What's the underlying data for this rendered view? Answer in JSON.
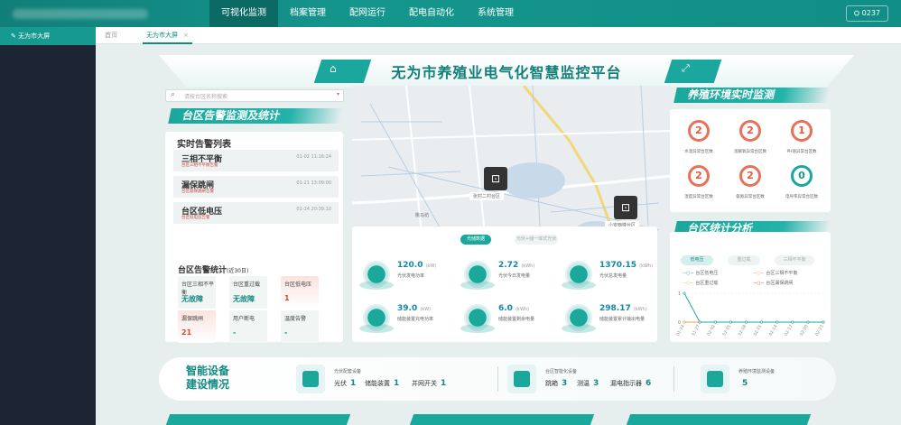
{
  "nav": {
    "items": [
      "可视化监测",
      "档案管理",
      "配网运行",
      "配电自动化",
      "系统管理"
    ],
    "user": "0237"
  },
  "sidebar": {
    "item": "无为市大屏"
  },
  "tabs": {
    "home": "首页",
    "active": "无为市大屏"
  },
  "header": {
    "title": "无为市养殖业电气化智慧监控平台"
  },
  "search": {
    "placeholder": "请按台区名称搜索"
  },
  "alarm_panel": {
    "title": "台区告警监测及统计",
    "list_title": "实时告警列表",
    "alarms": [
      {
        "title": "三相不平衡",
        "sub": "台区三相不平衡告警",
        "time": "01-02 11:16:24"
      },
      {
        "title": "漏保跳闸",
        "sub": "台区漏保跳闸告警",
        "time": "01-21 13:09:00"
      },
      {
        "title": "台区低电压",
        "sub": "台区低电压告警",
        "time": "01-24 20:39:10"
      }
    ],
    "stats_title": "台区告警统计",
    "stats_period": "(近30日)",
    "stats": [
      {
        "label": "台区三相不平衡",
        "value": "无故障"
      },
      {
        "label": "台区重过载",
        "value": "无故障"
      },
      {
        "label": "台区低电压",
        "value": "1"
      },
      {
        "label": "漏保跳闸",
        "value": "21"
      },
      {
        "label": "用户断电",
        "value": "-"
      },
      {
        "label": "温度告警",
        "value": "-"
      }
    ]
  },
  "map": {
    "markers": [
      "张村二村台区",
      "小安西楼台区"
    ],
    "places": [
      "桃马坊",
      "黄郢"
    ]
  },
  "power": {
    "tabs": [
      "光储数据",
      "光伏+储一体式光伏"
    ],
    "items": [
      {
        "value": "120.0",
        "unit": "(kW)",
        "label": "光伏发电功率"
      },
      {
        "value": "2.72",
        "unit": "(kWh)",
        "label": "光伏今日发电量"
      },
      {
        "value": "1370.15",
        "unit": "(kWh)",
        "label": "光伏总发电量"
      },
      {
        "value": "39.0",
        "unit": "(kW)",
        "label": "储能装置充电功率"
      },
      {
        "value": "6.0",
        "unit": "(kWh)",
        "label": "储能装置剩余电量"
      },
      {
        "value": "298.17",
        "unit": "(kWh)",
        "label": "储能装置累计输出电量"
      }
    ]
  },
  "env": {
    "title": "养殖环境实时监测",
    "items": [
      {
        "value": "2",
        "label": "水温异常台区数"
      },
      {
        "value": "2",
        "label": "溶解氧异常台区数"
      },
      {
        "value": "1",
        "label": "PH值异常台区数"
      },
      {
        "value": "2",
        "label": "湿度异常台区数"
      },
      {
        "value": "2",
        "label": "氨氮异常台区数"
      },
      {
        "value": "0",
        "label": "电导率异常台区数"
      }
    ]
  },
  "stat_panel": {
    "title": "台区统计分析",
    "tabs": [
      "低电压",
      "重过载",
      "三相不平衡"
    ]
  },
  "chart_data": {
    "type": "line",
    "x": [
      "01-24",
      "01-27",
      "02-02",
      "02-05",
      "02-08",
      "02-11",
      "02-14",
      "02-17",
      "02-20",
      "02-23"
    ],
    "series": [
      {
        "name": "台区低电压",
        "values": [
          1,
          0,
          0,
          0,
          0,
          0,
          0,
          0,
          0,
          0
        ],
        "color": "#1aa89d"
      },
      {
        "name": "台区三相不平衡",
        "values": [
          0,
          0,
          0,
          0,
          0,
          0,
          0,
          0,
          0,
          0
        ],
        "color": "#f0a04b"
      },
      {
        "name": "台区重过载",
        "values": [
          0,
          0,
          0,
          0,
          0,
          0,
          0,
          0,
          0,
          0
        ],
        "color": "#e6c14a"
      },
      {
        "name": "台区漏保跳闸",
        "values": [
          0,
          0,
          0,
          0,
          0,
          0,
          0,
          0,
          0,
          0
        ],
        "color": "#e0452e"
      }
    ],
    "ylim": [
      0,
      1
    ],
    "yticks": [
      "1",
      "0"
    ]
  },
  "bottom": {
    "title1": "智能设备",
    "title2": "建设情况",
    "groups": [
      {
        "title": "光伏配套设备",
        "items": [
          {
            "label": "光伏",
            "value": "1"
          },
          {
            "label": "储能装置",
            "value": "1"
          },
          {
            "label": "并网开关",
            "value": "1"
          }
        ]
      },
      {
        "title": "台区智能化设备",
        "items": [
          {
            "label": "跳箱",
            "value": "3"
          },
          {
            "label": "测温",
            "value": "3"
          },
          {
            "label": "漏电指示器",
            "value": "6"
          }
        ]
      },
      {
        "title": "养殖环境监测设备",
        "items": [
          {
            "label": "",
            "value": "5"
          }
        ]
      }
    ]
  }
}
